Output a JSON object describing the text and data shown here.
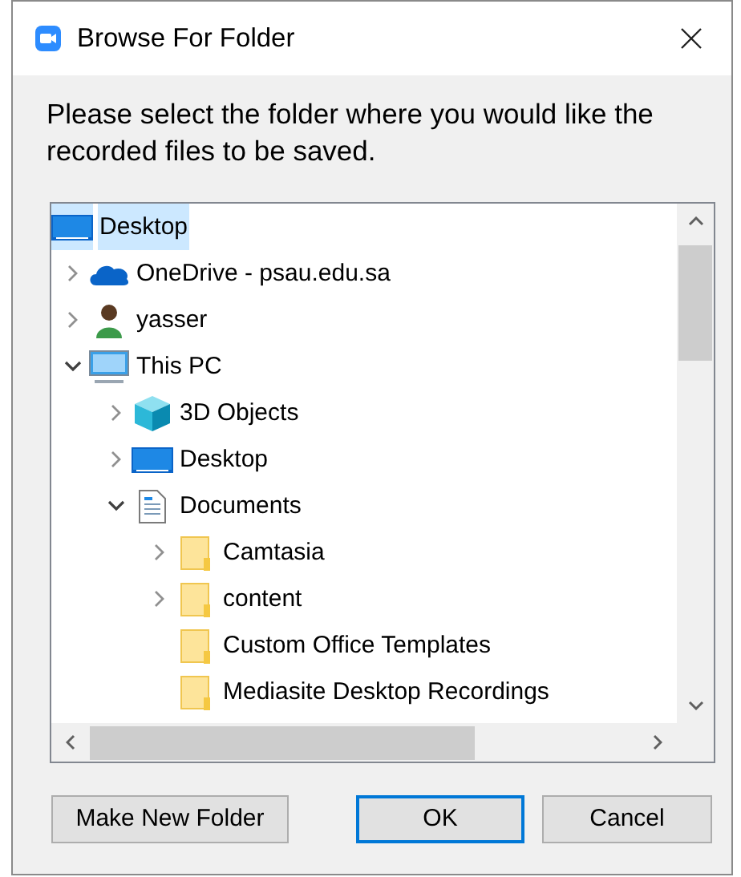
{
  "window": {
    "title": "Browse For Folder"
  },
  "prompt": "Please select the folder where you would like the recorded files to be saved.",
  "tree": [
    {
      "label": "Desktop",
      "kind": "desktop",
      "selected": true,
      "children": [
        {
          "label": "OneDrive - psau.edu.sa",
          "kind": "cloud",
          "selected": false,
          "expanded": false
        },
        {
          "label": "yasser",
          "kind": "user",
          "selected": false,
          "expanded": false
        },
        {
          "label": "This PC",
          "kind": "computer",
          "selected": false,
          "expanded": true,
          "children": [
            {
              "label": "3D Objects",
              "kind": "cube",
              "selected": false,
              "expanded": false
            },
            {
              "label": "Desktop",
              "kind": "desktop",
              "selected": false,
              "expanded": false
            },
            {
              "label": "Documents",
              "kind": "documents",
              "selected": false,
              "expanded": true,
              "children": [
                {
                  "label": "Camtasia",
                  "kind": "folder",
                  "selected": false,
                  "expanded": false
                },
                {
                  "label": "content",
                  "kind": "folder",
                  "selected": false,
                  "expanded": false
                },
                {
                  "label": "Custom Office Templates",
                  "kind": "folder",
                  "selected": false
                },
                {
                  "label": "Mediasite Desktop Recordings",
                  "kind": "folder",
                  "selected": false
                }
              ]
            }
          ]
        }
      ]
    }
  ],
  "buttons": [
    {
      "label": "Make New Folder",
      "default": false
    },
    {
      "label": "OK",
      "default": true
    },
    {
      "label": "Cancel",
      "default": false
    }
  ]
}
